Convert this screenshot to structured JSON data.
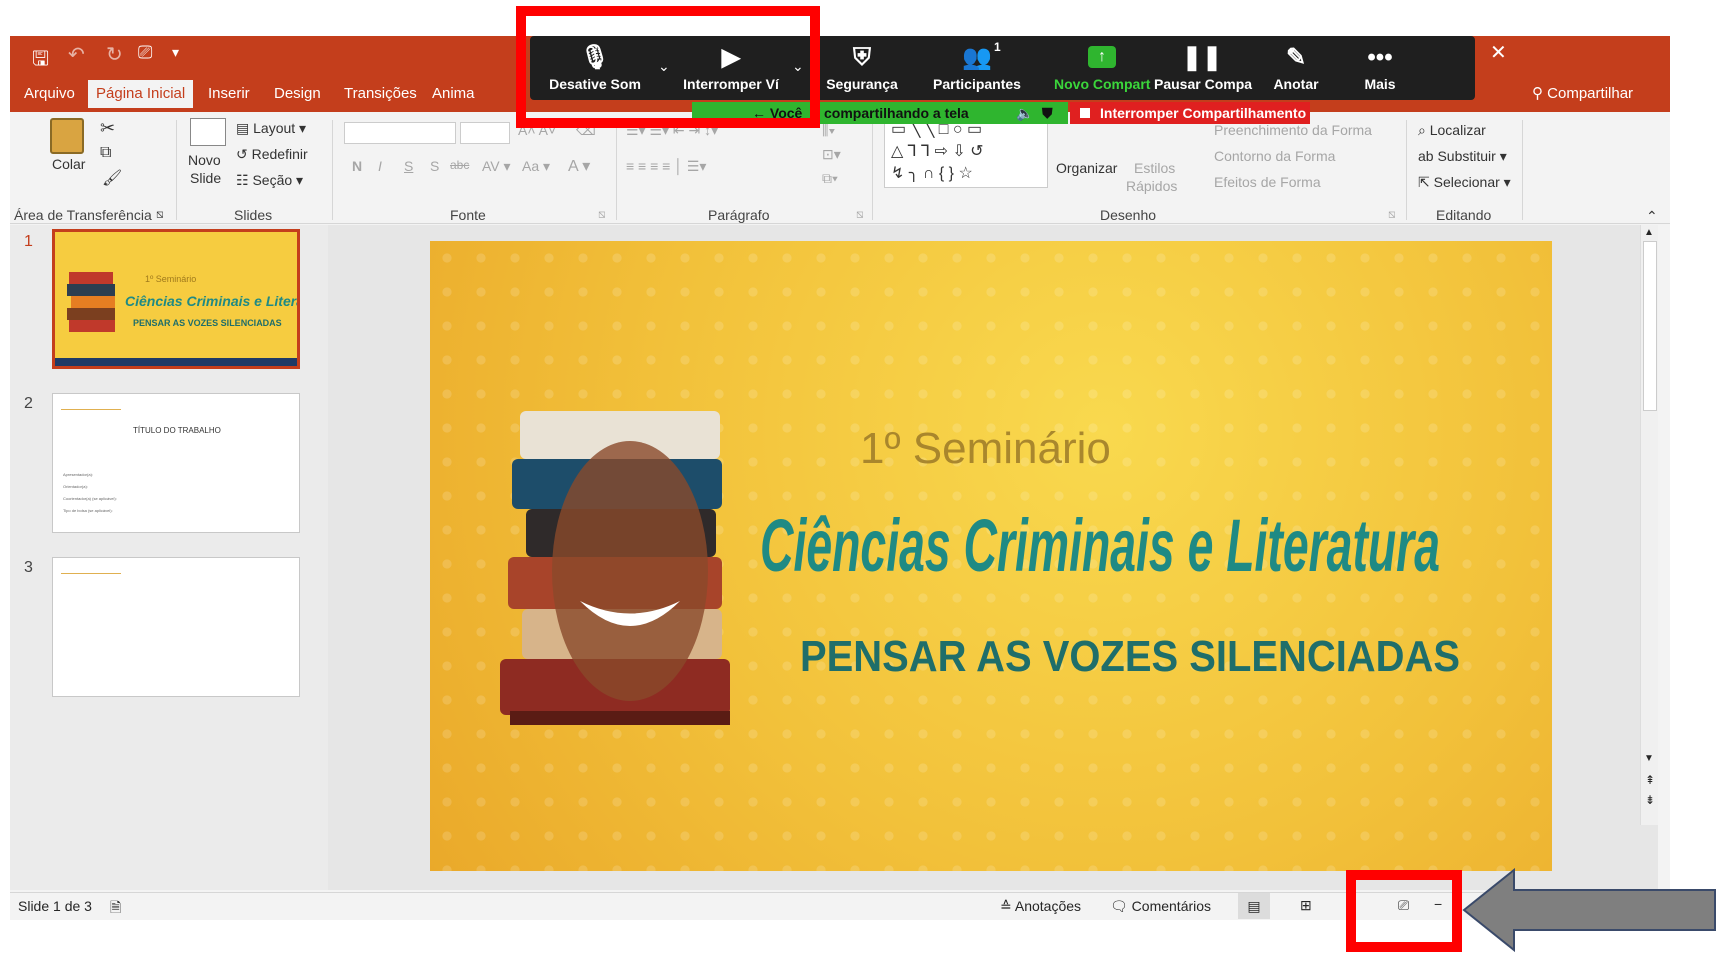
{
  "titlebar": {
    "share_label": "Compartilhar"
  },
  "tabs": [
    "Arquivo",
    "Página Inicial",
    "Inserir",
    "Design",
    "Transições",
    "Anima"
  ],
  "ribbon": {
    "clipboard": {
      "paste": "Colar",
      "group": "Área de Transferência"
    },
    "slides": {
      "new_slide_1": "Novo",
      "new_slide_2": "Slide",
      "layout": "Layout",
      "reset": "Redefinir",
      "section": "Seção",
      "group": "Slides"
    },
    "font": {
      "bold": "N",
      "italic": "I",
      "underline": "S",
      "shadow": "S",
      "strike": "abc",
      "group": "Fonte"
    },
    "paragraph": {
      "group": "Parágrafo"
    },
    "drawing": {
      "arrange": "Organizar",
      "quick_styles_1": "Estilos",
      "quick_styles_2": "Rápidos",
      "shape_fill": "Preenchimento da Forma",
      "shape_outline": "Contorno da Forma",
      "shape_effects": "Efeitos de Forma",
      "group": "Desenho"
    },
    "editing": {
      "find": "Localizar",
      "replace": "Substituir",
      "select": "Selecionar",
      "group": "Editando"
    }
  },
  "zoom_toolbar": {
    "mute": "Desative Som",
    "stop_video": "Interromper Ví",
    "security": "Segurança",
    "participants": "Participantes",
    "participants_count": "1",
    "new_share": "Novo Compart",
    "pause_share": "Pausar Compa",
    "annotate": "Anotar",
    "more": "Mais",
    "sharing_status_prefix": "Você",
    "sharing_status": "compartilhando a tela",
    "stop_share": "Interromper Compartilhamento"
  },
  "thumbnails": [
    {
      "num": "1",
      "seminar": "1º Seminário",
      "title": "Ciências Criminais e Literatura",
      "subtitle": "PENSAR AS VOZES SILENCIADAS"
    },
    {
      "num": "2",
      "title": "TÍTULO DO TRABALHO",
      "lines": [
        "Apresentador(a):",
        "Orientador(a):",
        "Coorientador(a) (se aplicável):",
        "Tipo de bolsa (se aplicável):"
      ]
    },
    {
      "num": "3"
    }
  ],
  "slide": {
    "seminar": "1º Seminário",
    "title": "Ciências Criminais e Literatura",
    "subtitle": "PENSAR AS VOZES SILENCIADAS"
  },
  "statusbar": {
    "slide_counter": "Slide 1 de 3",
    "notes": "Anotações",
    "comments": "Comentários"
  },
  "colors": {
    "ppt_accent": "#c43e1c",
    "zoom_bar": "#1f1f1f",
    "share_green": "#2fb52f",
    "stop_red": "#e02020",
    "annotation_red": "#ff0000",
    "arrow_gray": "#7f7f7f",
    "slide_yellow": "#f2c13a",
    "title_teal": "#1f8a84"
  }
}
